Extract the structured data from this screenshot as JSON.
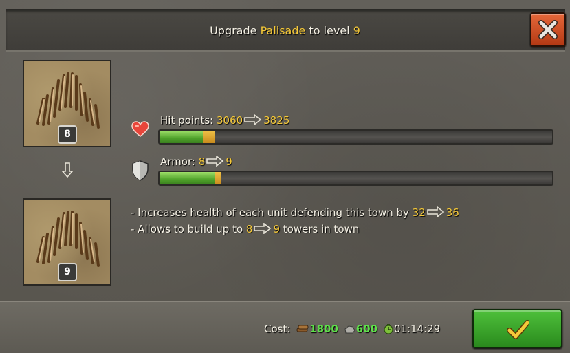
{
  "header": {
    "title_prefix": "Upgrade",
    "building": "Palisade",
    "title_mid": "to level",
    "target_level": "9"
  },
  "building_images": {
    "current_level": "8",
    "next_level": "9"
  },
  "stats": [
    {
      "icon": "heart-icon",
      "label": "Hit points:",
      "from": "3060",
      "to": "3825",
      "current_fraction": 0.11,
      "next_fraction": 0.14
    },
    {
      "icon": "shield-icon",
      "label": "Armor:",
      "from": "8",
      "to": "9",
      "current_fraction": 0.14,
      "next_fraction": 0.155
    }
  ],
  "effects": [
    {
      "text": "- Increases health of each unit defending this town by",
      "from": "32",
      "to": "36",
      "suffix": ""
    },
    {
      "text": "- Allows to build up to",
      "from": "8",
      "to": "9",
      "suffix": "towers in town"
    }
  ],
  "cost": {
    "label": "Cost:",
    "wood": "1800",
    "stone": "600",
    "time": "01:14:29"
  },
  "colors": {
    "highlight": "#f5c93a",
    "resource": "#5ee04a",
    "bar_fill": "#4fa22a",
    "bar_increase": "#f0c247",
    "close_button": "#c94a22",
    "confirm_button": "#36a126"
  }
}
